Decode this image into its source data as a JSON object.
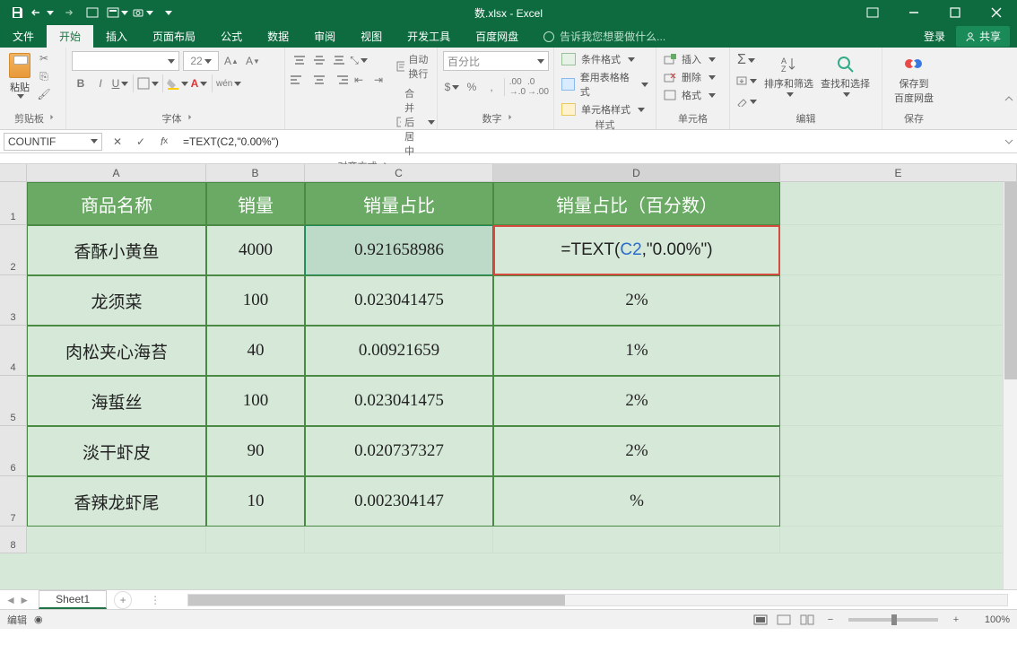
{
  "title": "数.xlsx - Excel",
  "tabs": {
    "file": "文件",
    "home": "开始",
    "insert": "插入",
    "layout": "页面布局",
    "formulas": "公式",
    "data": "数据",
    "review": "审阅",
    "view": "视图",
    "dev": "开发工具",
    "baidu": "百度网盘",
    "tell": "告诉我您想要做什么..."
  },
  "account": {
    "login": "登录",
    "share": "共享"
  },
  "ribbon": {
    "paste": "粘贴",
    "clipboard": "剪贴板",
    "font_name": "",
    "font_size": "22",
    "font_group": "字体",
    "align_group": "对齐方式",
    "wrap": "自动换行",
    "merge": "合并后居中",
    "number_format": "百分比",
    "number_group": "数字",
    "cond_fmt": "条件格式",
    "table_fmt": "套用表格格式",
    "cell_style": "单元格样式",
    "styles_group": "样式",
    "insert_cell": "插入",
    "delete_cell": "删除",
    "format_cell": "格式",
    "cells_group": "单元格",
    "sort": "排序和筛选",
    "find": "查找和选择",
    "edit_group": "编辑",
    "save_pan": "保存到\n百度网盘",
    "save_group": "保存"
  },
  "namebox": "COUNTIF",
  "formula": "=TEXT(C2,\"0.00%\")",
  "columns": [
    "A",
    "B",
    "C",
    "D",
    "E"
  ],
  "headers": {
    "A": "商品名称",
    "B": "销量",
    "C": "销量占比",
    "D": "销量占比（百分数）"
  },
  "rows": [
    {
      "A": "香酥小黄鱼",
      "B": "4000",
      "C": "0.921658986",
      "D_prefix": "=TEXT(",
      "D_ref": "C2",
      "D_suffix": ",\"0.00%\")"
    },
    {
      "A": "龙须菜",
      "B": "100",
      "C": "0.023041475",
      "D": "2%"
    },
    {
      "A": "肉松夹心海苔",
      "B": "40",
      "C": "0.00921659",
      "D": "1%"
    },
    {
      "A": "海蜇丝",
      "B": "100",
      "C": "0.023041475",
      "D": "2%"
    },
    {
      "A": "淡干虾皮",
      "B": "90",
      "C": "0.020737327",
      "D": "2%"
    },
    {
      "A": "香辣龙虾尾",
      "B": "10",
      "C": "0.002304147",
      "D": "%"
    }
  ],
  "sheet_tab": "Sheet1",
  "status": "编辑",
  "zoom": "100%"
}
